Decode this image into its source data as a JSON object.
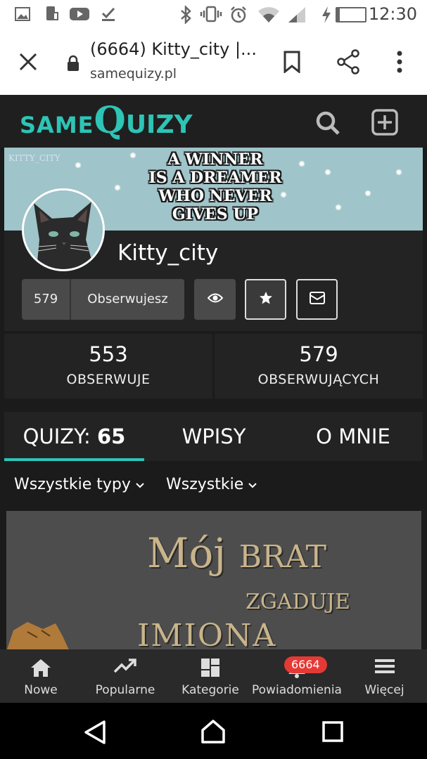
{
  "status_bar": {
    "time": "12:30",
    "battery_percent": "11%",
    "battery_level": 0.11,
    "icons": [
      "gallery-icon",
      "phone-charge-icon",
      "youtube-icon",
      "download-done-icon",
      "bluetooth-icon",
      "vibrate-icon",
      "alarm-icon",
      "wifi-icon",
      "signal-icon",
      "charging-bolt-icon"
    ]
  },
  "browser": {
    "title": "(6664) Kitty_city |...",
    "domain": "samequizy.pl",
    "icons": [
      "close-icon",
      "lock-icon",
      "bookmark-icon",
      "share-icon",
      "more-vert-icon"
    ]
  },
  "site": {
    "logo_same": "SAME",
    "logo_q": "Q",
    "logo_uizy": "UIZY",
    "icons": [
      "search-icon",
      "add-box-icon"
    ]
  },
  "banner": {
    "quote_lines": [
      "A WINNER",
      "IS A DREAMER",
      "WHO NEVER",
      "GIVES UP"
    ],
    "watermark": "KITTY_CITY"
  },
  "profile": {
    "username": "Kitty_city",
    "followers_count_badge": "579",
    "follow_label": "Obserwujesz"
  },
  "stats": [
    {
      "value": "553",
      "label": "OBSERWUJE"
    },
    {
      "value": "579",
      "label": "OBSERWUJĄCYCH"
    }
  ],
  "tabs": {
    "quizy_label": "QUIZY:",
    "quizy_count": "65",
    "wpisy": "WPISY",
    "o_mnie": "O MNIE"
  },
  "filters": {
    "type": "Wszystkie typy",
    "range": "Wszystkie"
  },
  "quiz_card": {
    "title_line1_a": "Mój",
    "title_line1_b": "BRAT",
    "title_line2": "ZGADUJE",
    "title_line3": "IMIONA"
  },
  "bottom_nav": {
    "items": [
      "Nowe",
      "Popularne",
      "Kategorie",
      "Powiadomienia",
      "Więcej"
    ],
    "notification_badge": "6664"
  },
  "colors": {
    "accent": "#2ec4b6",
    "badge": "#e53935",
    "background": "#1b1b1b",
    "card": "#232323"
  }
}
